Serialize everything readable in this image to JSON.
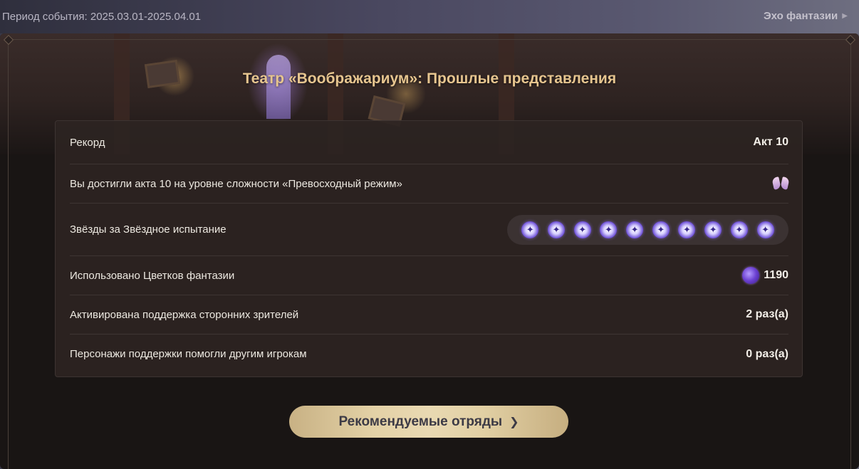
{
  "header": {
    "period_text": "Период события: 2025.03.01-2025.04.01",
    "echo_link": "Эхо фантазии"
  },
  "panel": {
    "title": "Театр «Воображариум»: Прошлые представления"
  },
  "stats": {
    "record": {
      "label": "Рекорд",
      "value": "Акт 10"
    },
    "difficulty": {
      "label": "Вы достигли акта 10 на уровне сложности «Превосходный режим»",
      "icon": "butterfly-icon"
    },
    "stars": {
      "label": "Звёзды за Звёздное испытание",
      "count": 10,
      "icon": "star-medal-icon"
    },
    "flowers": {
      "label": "Использовано Цветков фантазии",
      "value": "1190",
      "icon": "fantasy-flower-icon"
    },
    "support_activated": {
      "label": "Активирована поддержка сторонних зрителей",
      "value": "2 раз(а)"
    },
    "support_helped": {
      "label": "Персонажи поддержки помогли другим игрокам",
      "value": "0 раз(а)"
    }
  },
  "actions": {
    "recommended_teams": "Рекомендуемые отряды"
  },
  "colors": {
    "title_gold": "#e6c58f",
    "button_gold": "#e3d1a6",
    "card_bg": "#2c2422",
    "star_purple": "#6a4bd6"
  }
}
